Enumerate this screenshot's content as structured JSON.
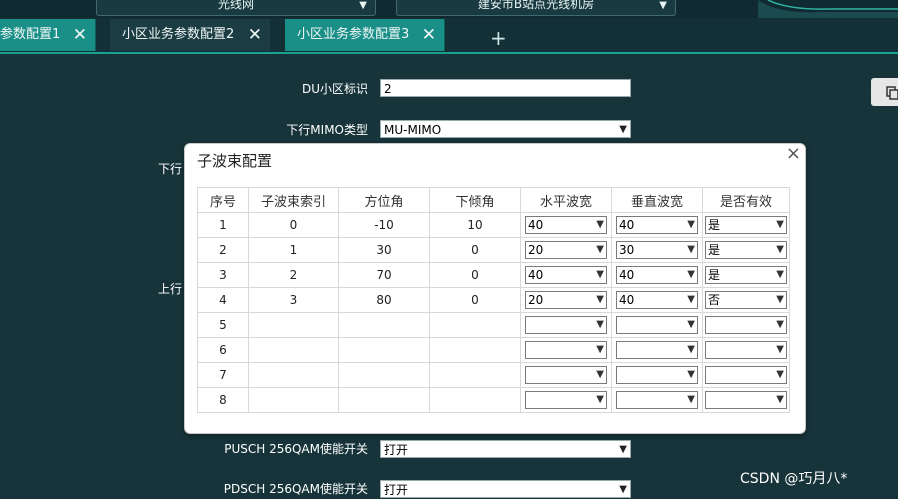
{
  "top": {
    "select_left": "光线网",
    "select_right": "建安市B站点光线机房"
  },
  "tabs": [
    {
      "label": "参数配置1"
    },
    {
      "label": "小区业务参数配置2"
    },
    {
      "label": "小区业务参数配置3"
    }
  ],
  "tab_add": "+",
  "form": {
    "du_label": "DU小区标识",
    "du_value": "2",
    "mimo_label": "下行MIMO类型",
    "mimo_value": "MU-MIMO",
    "hidden_label_1": "下行",
    "hidden_label_2": "上行",
    "pusch_label": "PUSCH 256QAM使能开关",
    "pusch_value": "打开",
    "pdsch_label": "PDSCH 256QAM使能开关",
    "pdsch_value": "打开"
  },
  "dialog": {
    "title": "子波束配置",
    "close": "×",
    "columns": [
      "序号",
      "子波束索引",
      "方位角",
      "下倾角",
      "水平波宽",
      "垂直波宽",
      "是否有效"
    ],
    "rows": [
      {
        "no": "1",
        "index": "0",
        "azimuth": "-10",
        "tilt": "10",
        "h_width": "40",
        "v_width": "40",
        "valid": "是"
      },
      {
        "no": "2",
        "index": "1",
        "azimuth": "30",
        "tilt": "0",
        "h_width": "20",
        "v_width": "30",
        "valid": "是"
      },
      {
        "no": "3",
        "index": "2",
        "azimuth": "70",
        "tilt": "0",
        "h_width": "40",
        "v_width": "40",
        "valid": "是"
      },
      {
        "no": "4",
        "index": "3",
        "azimuth": "80",
        "tilt": "0",
        "h_width": "20",
        "v_width": "40",
        "valid": "否"
      },
      {
        "no": "5",
        "index": "",
        "azimuth": "",
        "tilt": "",
        "h_width": "",
        "v_width": "",
        "valid": ""
      },
      {
        "no": "6",
        "index": "",
        "azimuth": "",
        "tilt": "",
        "h_width": "",
        "v_width": "",
        "valid": ""
      },
      {
        "no": "7",
        "index": "",
        "azimuth": "",
        "tilt": "",
        "h_width": "",
        "v_width": "",
        "valid": ""
      },
      {
        "no": "8",
        "index": "",
        "azimuth": "",
        "tilt": "",
        "h_width": "",
        "v_width": "",
        "valid": ""
      }
    ]
  },
  "watermark": "CSDN @巧月八⁠⁠*",
  "colors": {
    "background": "#17343a",
    "tab_inactive": "#1a8f87",
    "tab_active": "#1b3c42",
    "accent": "#1aa192"
  }
}
